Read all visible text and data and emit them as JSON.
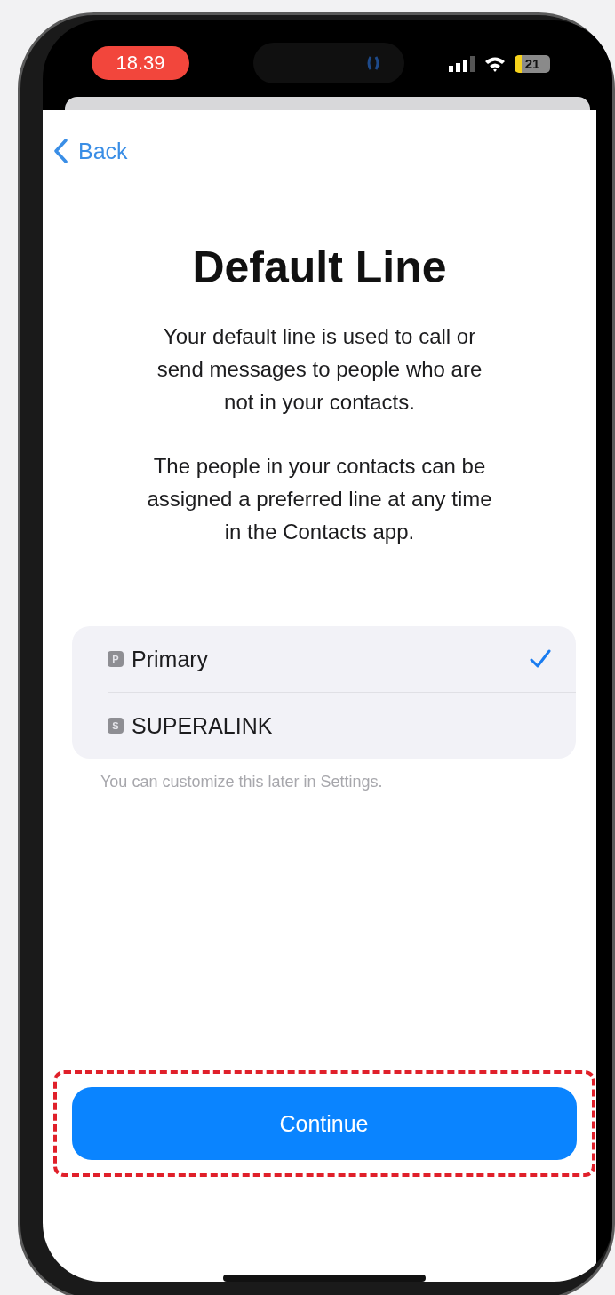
{
  "status_bar": {
    "time": "18.39",
    "battery": "21"
  },
  "nav": {
    "back": "Back"
  },
  "title": "Default Line",
  "paragraphs": [
    "Your default line is used to call or send messages to people who are not in your contacts.",
    "The people in your contacts can be assigned a preferred line at any time in the Contacts app."
  ],
  "lines": [
    {
      "badge": "P",
      "name": "Primary",
      "selected": true
    },
    {
      "badge": "S",
      "name": "SUPERALINK",
      "selected": false
    }
  ],
  "footnote": "You can customize this later in Settings.",
  "button": "Continue"
}
